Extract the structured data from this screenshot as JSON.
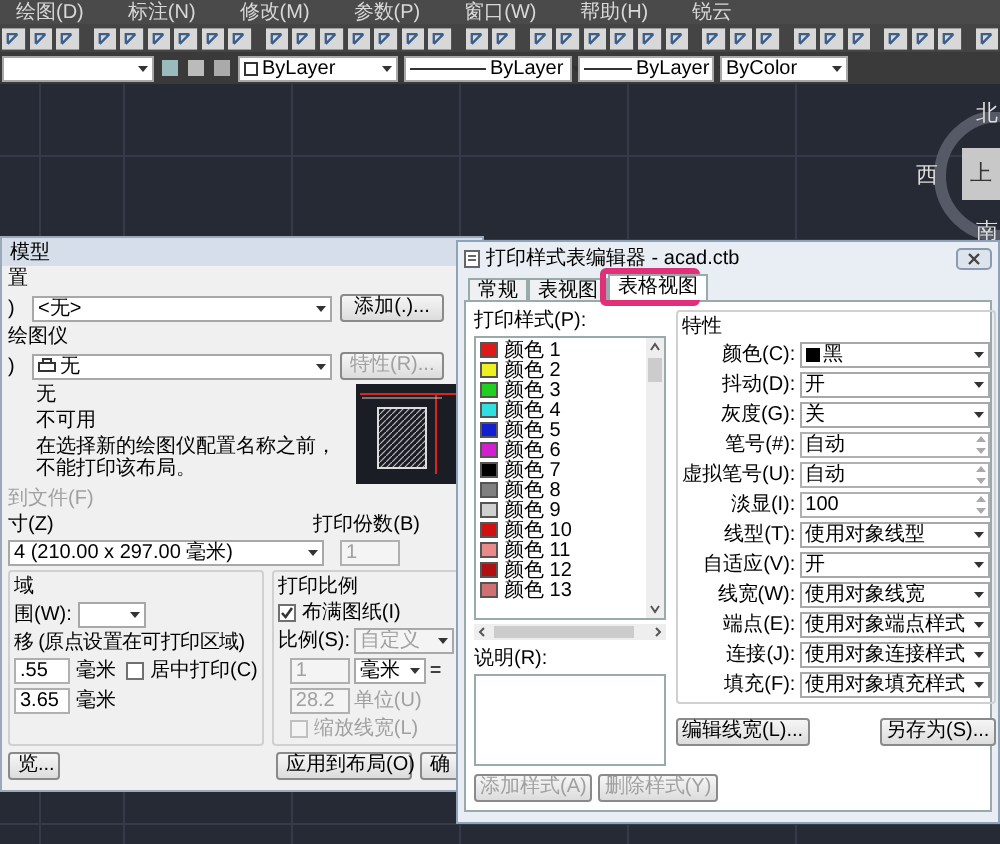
{
  "menu_bar": [
    {
      "label": "绘图(D)"
    },
    {
      "label": "标注(N)"
    },
    {
      "label": "修改(M)"
    },
    {
      "label": "参数(P)"
    },
    {
      "label": "窗口(W)"
    },
    {
      "label": "帮助(H)"
    },
    {
      "label": "锐云"
    }
  ],
  "properties_bar": [
    {
      "kind": "color",
      "value": "ByLayer"
    },
    {
      "kind": "linetype",
      "value": "ByLayer"
    },
    {
      "kind": "lineweight",
      "value": "ByLayer"
    },
    {
      "kind": "plain",
      "value": "ByColor"
    }
  ],
  "viewcube": {
    "north": "北",
    "west": "西",
    "south": "南",
    "face": "上"
  },
  "page_setup": {
    "title": "模型",
    "page_setup_heading": "置",
    "name_label": ")",
    "name_value": "<无>",
    "add_button": "添加(.)...",
    "printer_heading": "绘图仪",
    "printer_label": ")",
    "printer_value": "无",
    "properties_button": {
      "label": "特性(R)...",
      "disabled": true
    },
    "info": [
      "无",
      "不可用",
      "在选择新的绘图仪配置名称之前，不能打印该布局。"
    ],
    "print_to_file": {
      "label": "到文件(F)",
      "disabled": true
    },
    "paper_size_label": "寸(Z)",
    "paper_size_value": "4 (210.00 x 297.00 毫米)",
    "copies_label": "打印份数(B)",
    "copies_value": "1",
    "area_heading": "域",
    "area_label": "围(W):",
    "offset_heading": "移 (原点设置在可打印区域)",
    "x_value": ".55",
    "x_unit": "毫米",
    "y_value": "3.65",
    "y_unit": "毫米",
    "center": {
      "label": "居中打印(C)",
      "checked": false
    },
    "scale_heading": "打印比例",
    "fit": {
      "label": "布满图纸(I)",
      "checked": true
    },
    "scale_label": "比例(S):",
    "scale_value": "自定义",
    "scale_a": "1",
    "scale_unit": "毫米",
    "equals": "=",
    "scale_b": "28.2",
    "scale_b_unit": "单位(U)",
    "lineweights": {
      "label": "缩放线宽(L)",
      "checked": false,
      "disabled": true
    },
    "buttons": [
      {
        "label": "览..."
      },
      {
        "label": "应用到布局(O)"
      },
      {
        "label": "确"
      }
    ]
  },
  "plot_style_editor": {
    "title": "打印样式表编辑器 - acad.ctb",
    "tabs": [
      {
        "label": "常规",
        "selected": false
      },
      {
        "label": "表视图",
        "selected": false
      },
      {
        "label": "表格视图",
        "selected": true
      }
    ],
    "styles_label": "打印样式(P):",
    "styles": [
      {
        "name": "颜色 1",
        "color": "#e01818"
      },
      {
        "name": "颜色 2",
        "color": "#f0f020"
      },
      {
        "name": "颜色 3",
        "color": "#20d020"
      },
      {
        "name": "颜色 4",
        "color": "#30e0e0"
      },
      {
        "name": "颜色 5",
        "color": "#1020d0"
      },
      {
        "name": "颜色 6",
        "color": "#d020d0"
      },
      {
        "name": "颜色 7",
        "color": "#000000"
      },
      {
        "name": "颜色 8",
        "color": "#808080"
      },
      {
        "name": "颜色 9",
        "color": "#d0d0d0"
      },
      {
        "name": "颜色 10",
        "color": "#d01010"
      },
      {
        "name": "颜色 11",
        "color": "#e88a8a"
      },
      {
        "name": "颜色 12",
        "color": "#b01010"
      },
      {
        "name": "颜色 13",
        "color": "#d07070"
      }
    ],
    "description_label": "说明(R):",
    "add_style": {
      "label": "添加样式(A)",
      "disabled": true
    },
    "delete_style": {
      "label": "删除样式(Y)",
      "disabled": true
    },
    "properties_heading": "特性",
    "properties": [
      {
        "kind": "color",
        "label": "颜色(C):",
        "value": "黑",
        "color": "#000000"
      },
      {
        "kind": "select",
        "label": "抖动(D):",
        "value": "开"
      },
      {
        "kind": "select",
        "label": "灰度(G):",
        "value": "关"
      },
      {
        "kind": "spin",
        "label": "笔号(#):",
        "value": "自动"
      },
      {
        "kind": "spin",
        "label": "虚拟笔号(U):",
        "value": "自动"
      },
      {
        "kind": "spin",
        "label": "淡显(I):",
        "value": "100"
      },
      {
        "kind": "select",
        "label": "线型(T):",
        "value": "使用对象线型"
      },
      {
        "kind": "select",
        "label": "自适应(V):",
        "value": "开"
      },
      {
        "kind": "select",
        "label": "线宽(W):",
        "value": "使用对象线宽"
      },
      {
        "kind": "select",
        "label": "端点(E):",
        "value": "使用对象端点样式"
      },
      {
        "kind": "select",
        "label": "连接(J):",
        "value": "使用对象连接样式"
      },
      {
        "kind": "select",
        "label": "填充(F):",
        "value": "使用对象填充样式"
      }
    ],
    "buttons": [
      {
        "label": "编辑线宽(L)..."
      },
      {
        "label": "另存为(S)..."
      }
    ]
  }
}
